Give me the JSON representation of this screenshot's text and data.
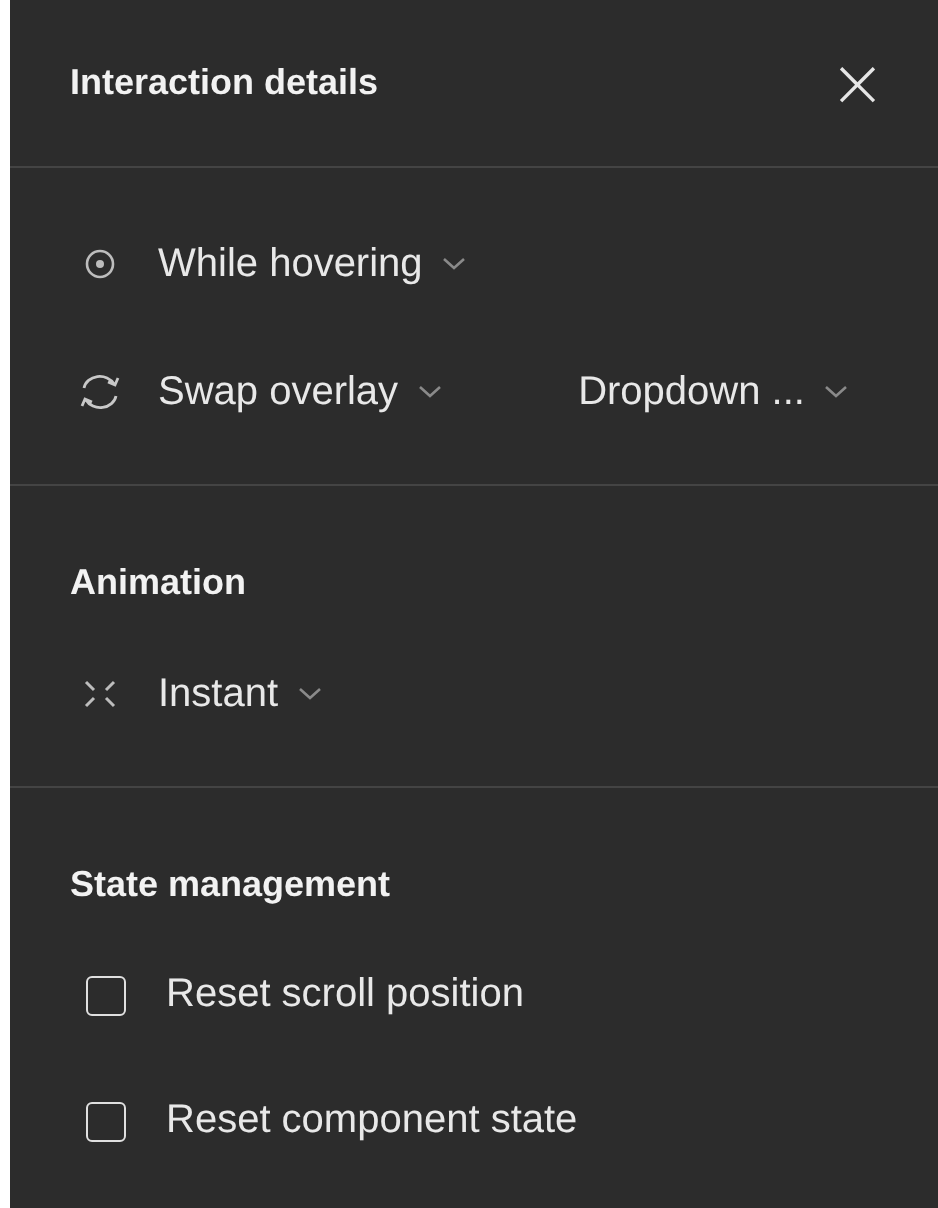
{
  "panel": {
    "title": "Interaction details",
    "close": "×"
  },
  "interaction": [
    {
      "kind": "hover",
      "label": "While hovering"
    },
    {
      "kind": "swap",
      "label": "Swap overlay",
      "target": "Dropdown ..."
    }
  ],
  "animation": {
    "heading": "Animation",
    "items": [
      {
        "kind": "instant",
        "label": "Instant"
      }
    ]
  },
  "state_management": {
    "heading": "State management",
    "options": [
      {
        "label": "Reset scroll position",
        "checked": false
      },
      {
        "label": "Reset component state",
        "checked": false
      }
    ]
  }
}
